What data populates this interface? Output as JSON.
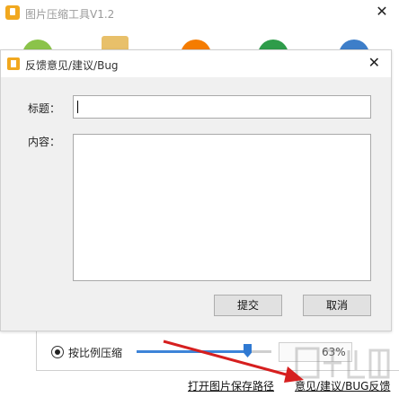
{
  "window": {
    "title": "图片压缩工具V1.2",
    "close": "✕"
  },
  "toolbar": {
    "icons": [
      "green-circle-icon",
      "folder-icon",
      "orange-circle-icon",
      "green-check-icon",
      "blue-info-icon"
    ]
  },
  "options": {
    "radio_label": "按比例压缩",
    "radio_selected": true,
    "slider_percent": 63,
    "percent_text": "63%"
  },
  "links": {
    "open_path": "打开图片保存路径",
    "feedback": "意见/建议/BUG反馈"
  },
  "dialog": {
    "title": "反馈意见/建议/Bug",
    "close": "✕",
    "title_label": "标题：",
    "title_value": "",
    "content_label": "内容：",
    "content_value": "",
    "submit": "提交",
    "cancel": "取消"
  },
  "colors": {
    "accent_orange": "#f1a81f",
    "slider_blue": "#2f79d2",
    "arrow_red": "#d61f1f"
  }
}
